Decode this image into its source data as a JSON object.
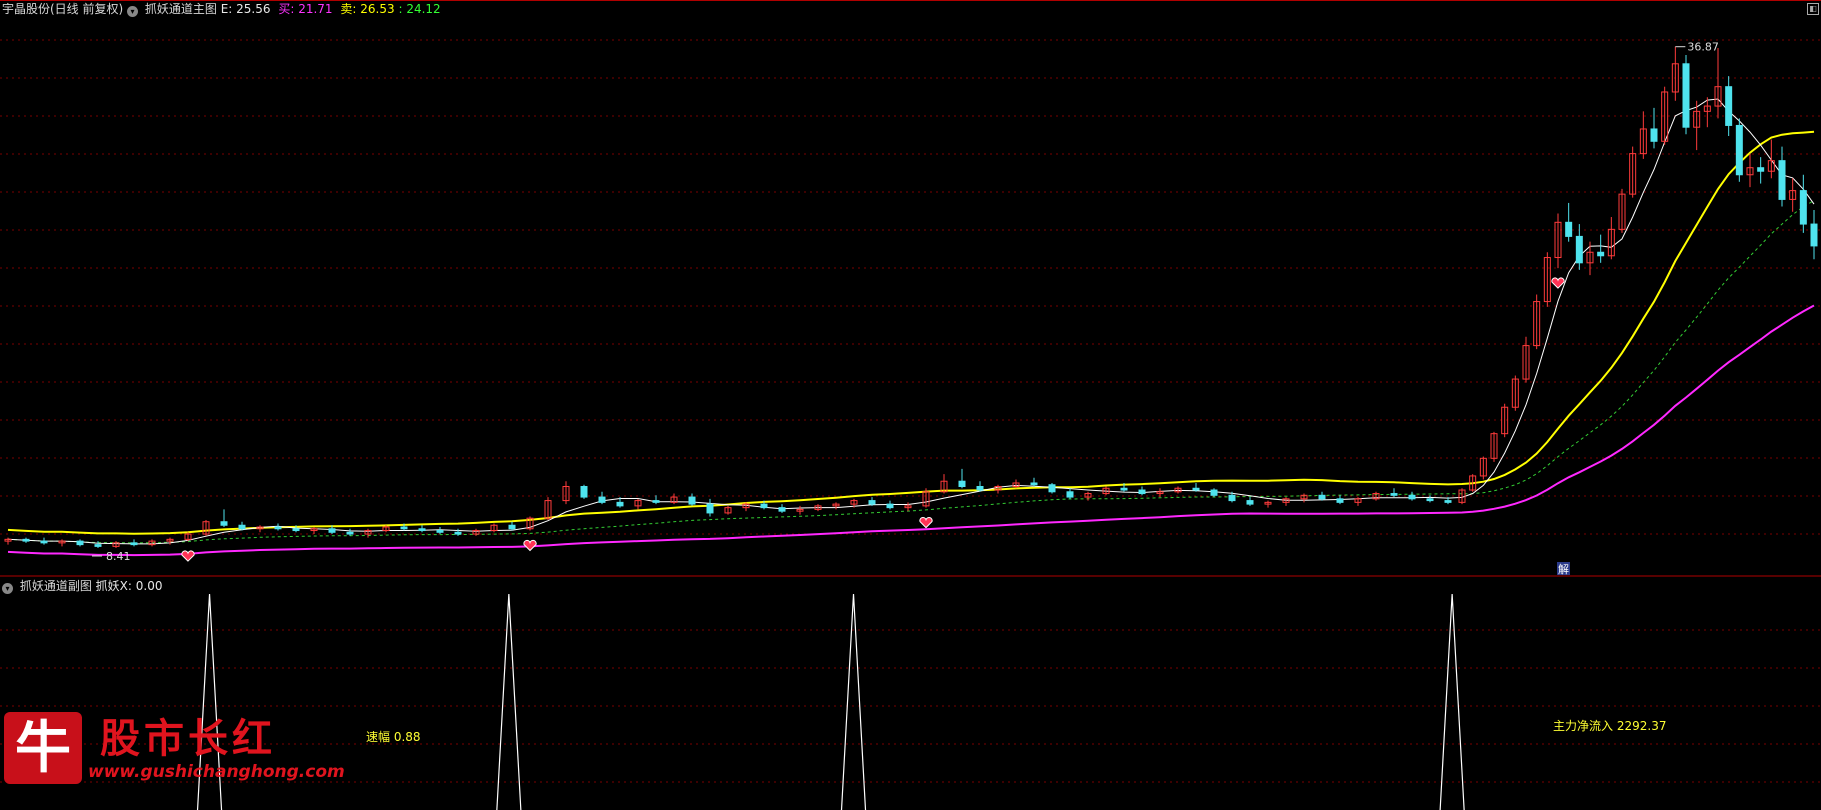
{
  "header": {
    "stock_name": "宇晶股份(日线 前复权)",
    "indicator_name": "抓妖通道主图",
    "e_label": "E:",
    "e_value": "25.56",
    "buy_label": "买:",
    "buy_value": "21.71",
    "sell_label": "卖:",
    "sell_value": "26.53",
    "extra_value": "24.12"
  },
  "sub_header": {
    "indicator_name": "抓妖通道副图",
    "signal_label": "抓妖X:",
    "signal_value": "0.00"
  },
  "annotations": {
    "high_price": "36.87",
    "low_price": "8.41",
    "jie_marker": "解",
    "speed_label": "速幅",
    "speed_value": "0.88",
    "inflow_label": "主力净流入",
    "inflow_value": "2292.37"
  },
  "watermark": {
    "logo_char": "牛",
    "title": "股市长红",
    "url": "www.gushichanghong.com"
  },
  "colors": {
    "background": "#000000",
    "grid": "#7a0000",
    "up_candle": "#ff3b3b",
    "down_candle": "#4fe3ee",
    "yellow_line": "#ffff00",
    "magenta_line": "#ff28ff",
    "green_dash": "#33cc33",
    "white_line": "#ffffff",
    "header_yellow": "#ffff00",
    "header_magenta": "#ff33ff",
    "header_green": "#33ff33"
  },
  "chart_data": {
    "type": "candlestick",
    "title": "宇晶股份(日线 前复权)",
    "ylim": [
      7.5,
      38.5
    ],
    "candles": [
      {
        "o": 8.8,
        "h": 9.0,
        "l": 8.6,
        "c": 8.9
      },
      {
        "o": 8.9,
        "h": 9.0,
        "l": 8.7,
        "c": 8.8
      },
      {
        "o": 8.8,
        "h": 9.0,
        "l": 8.6,
        "c": 8.7
      },
      {
        "o": 8.7,
        "h": 8.9,
        "l": 8.5,
        "c": 8.8
      },
      {
        "o": 8.8,
        "h": 8.9,
        "l": 8.5,
        "c": 8.6
      },
      {
        "o": 8.6,
        "h": 8.8,
        "l": 8.41,
        "c": 8.5
      },
      {
        "o": 8.5,
        "h": 8.8,
        "l": 8.41,
        "c": 8.7
      },
      {
        "o": 8.7,
        "h": 8.9,
        "l": 8.5,
        "c": 8.6
      },
      {
        "o": 8.6,
        "h": 8.9,
        "l": 8.5,
        "c": 8.8
      },
      {
        "o": 8.8,
        "h": 9.0,
        "l": 8.6,
        "c": 8.9
      },
      {
        "o": 8.9,
        "h": 9.3,
        "l": 8.8,
        "c": 9.2
      },
      {
        "o": 9.2,
        "h": 10.0,
        "l": 9.1,
        "c": 9.9
      },
      {
        "o": 9.9,
        "h": 10.6,
        "l": 9.6,
        "c": 9.7
      },
      {
        "o": 9.7,
        "h": 9.9,
        "l": 9.4,
        "c": 9.5
      },
      {
        "o": 9.5,
        "h": 9.7,
        "l": 9.3,
        "c": 9.6
      },
      {
        "o": 9.6,
        "h": 9.8,
        "l": 9.4,
        "c": 9.5
      },
      {
        "o": 9.5,
        "h": 9.7,
        "l": 9.3,
        "c": 9.4
      },
      {
        "o": 9.4,
        "h": 9.6,
        "l": 9.2,
        "c": 9.5
      },
      {
        "o": 9.5,
        "h": 9.7,
        "l": 9.2,
        "c": 9.3
      },
      {
        "o": 9.3,
        "h": 9.5,
        "l": 9.1,
        "c": 9.2
      },
      {
        "o": 9.2,
        "h": 9.5,
        "l": 9.0,
        "c": 9.4
      },
      {
        "o": 9.4,
        "h": 9.7,
        "l": 9.3,
        "c": 9.6
      },
      {
        "o": 9.6,
        "h": 9.8,
        "l": 9.4,
        "c": 9.5
      },
      {
        "o": 9.5,
        "h": 9.7,
        "l": 9.3,
        "c": 9.4
      },
      {
        "o": 9.4,
        "h": 9.6,
        "l": 9.2,
        "c": 9.3
      },
      {
        "o": 9.3,
        "h": 9.5,
        "l": 9.1,
        "c": 9.2
      },
      {
        "o": 9.2,
        "h": 9.5,
        "l": 9.1,
        "c": 9.4
      },
      {
        "o": 9.4,
        "h": 9.8,
        "l": 9.3,
        "c": 9.7
      },
      {
        "o": 9.7,
        "h": 9.9,
        "l": 9.4,
        "c": 9.5
      },
      {
        "o": 9.5,
        "h": 10.2,
        "l": 9.4,
        "c": 10.1
      },
      {
        "o": 10.1,
        "h": 11.3,
        "l": 10.0,
        "c": 11.1
      },
      {
        "o": 11.1,
        "h": 12.2,
        "l": 10.9,
        "c": 11.9
      },
      {
        "o": 11.9,
        "h": 12.0,
        "l": 11.2,
        "c": 11.3
      },
      {
        "o": 11.3,
        "h": 11.6,
        "l": 10.9,
        "c": 11.0
      },
      {
        "o": 11.0,
        "h": 11.3,
        "l": 10.7,
        "c": 10.8
      },
      {
        "o": 10.8,
        "h": 11.2,
        "l": 10.6,
        "c": 11.1
      },
      {
        "o": 11.1,
        "h": 11.4,
        "l": 10.9,
        "c": 11.0
      },
      {
        "o": 11.0,
        "h": 11.5,
        "l": 10.9,
        "c": 11.3
      },
      {
        "o": 11.3,
        "h": 11.5,
        "l": 10.8,
        "c": 10.9
      },
      {
        "o": 10.9,
        "h": 11.2,
        "l": 10.2,
        "c": 10.4
      },
      {
        "o": 10.4,
        "h": 10.8,
        "l": 10.3,
        "c": 10.7
      },
      {
        "o": 10.7,
        "h": 11.0,
        "l": 10.5,
        "c": 10.9
      },
      {
        "o": 10.9,
        "h": 11.1,
        "l": 10.6,
        "c": 10.7
      },
      {
        "o": 10.7,
        "h": 10.9,
        "l": 10.4,
        "c": 10.5
      },
      {
        "o": 10.5,
        "h": 10.8,
        "l": 10.3,
        "c": 10.6
      },
      {
        "o": 10.6,
        "h": 10.9,
        "l": 10.5,
        "c": 10.8
      },
      {
        "o": 10.8,
        "h": 11.0,
        "l": 10.6,
        "c": 10.9
      },
      {
        "o": 10.9,
        "h": 11.2,
        "l": 10.7,
        "c": 11.1
      },
      {
        "o": 11.1,
        "h": 11.3,
        "l": 10.8,
        "c": 10.9
      },
      {
        "o": 10.9,
        "h": 11.1,
        "l": 10.6,
        "c": 10.7
      },
      {
        "o": 10.7,
        "h": 11.0,
        "l": 10.5,
        "c": 10.8
      },
      {
        "o": 10.8,
        "h": 11.8,
        "l": 10.7,
        "c": 11.6
      },
      {
        "o": 11.6,
        "h": 12.6,
        "l": 11.5,
        "c": 12.2
      },
      {
        "o": 12.2,
        "h": 12.9,
        "l": 11.8,
        "c": 11.9
      },
      {
        "o": 11.9,
        "h": 12.2,
        "l": 11.6,
        "c": 11.7
      },
      {
        "o": 11.7,
        "h": 12.0,
        "l": 11.5,
        "c": 11.9
      },
      {
        "o": 11.9,
        "h": 12.3,
        "l": 11.8,
        "c": 12.1
      },
      {
        "o": 12.1,
        "h": 12.4,
        "l": 11.9,
        "c": 12.0
      },
      {
        "o": 12.0,
        "h": 12.1,
        "l": 11.5,
        "c": 11.6
      },
      {
        "o": 11.6,
        "h": 11.8,
        "l": 11.2,
        "c": 11.3
      },
      {
        "o": 11.3,
        "h": 11.6,
        "l": 11.1,
        "c": 11.5
      },
      {
        "o": 11.5,
        "h": 11.9,
        "l": 11.4,
        "c": 11.8
      },
      {
        "o": 11.8,
        "h": 12.1,
        "l": 11.6,
        "c": 11.7
      },
      {
        "o": 11.7,
        "h": 11.9,
        "l": 11.4,
        "c": 11.5
      },
      {
        "o": 11.5,
        "h": 11.8,
        "l": 11.3,
        "c": 11.6
      },
      {
        "o": 11.6,
        "h": 11.9,
        "l": 11.5,
        "c": 11.8
      },
      {
        "o": 11.8,
        "h": 12.1,
        "l": 11.6,
        "c": 11.7
      },
      {
        "o": 11.7,
        "h": 11.8,
        "l": 11.3,
        "c": 11.4
      },
      {
        "o": 11.4,
        "h": 11.6,
        "l": 11.0,
        "c": 11.1
      },
      {
        "o": 11.1,
        "h": 11.3,
        "l": 10.8,
        "c": 10.9
      },
      {
        "o": 10.9,
        "h": 11.1,
        "l": 10.7,
        "c": 11.0
      },
      {
        "o": 11.0,
        "h": 11.3,
        "l": 10.8,
        "c": 11.2
      },
      {
        "o": 11.2,
        "h": 11.5,
        "l": 11.0,
        "c": 11.4
      },
      {
        "o": 11.4,
        "h": 11.6,
        "l": 11.1,
        "c": 11.2
      },
      {
        "o": 11.2,
        "h": 11.4,
        "l": 10.9,
        "c": 11.0
      },
      {
        "o": 11.0,
        "h": 11.3,
        "l": 10.8,
        "c": 11.2
      },
      {
        "o": 11.2,
        "h": 11.6,
        "l": 11.1,
        "c": 11.5
      },
      {
        "o": 11.5,
        "h": 11.8,
        "l": 11.3,
        "c": 11.4
      },
      {
        "o": 11.4,
        "h": 11.6,
        "l": 11.1,
        "c": 11.2
      },
      {
        "o": 11.2,
        "h": 11.4,
        "l": 11.0,
        "c": 11.1
      },
      {
        "o": 11.1,
        "h": 11.3,
        "l": 10.9,
        "c": 11.0
      }
    ],
    "rally_candles": [
      {
        "o": 11.0,
        "h": 11.8,
        "l": 10.9,
        "c": 11.7
      },
      {
        "o": 11.7,
        "h": 12.6,
        "l": 11.6,
        "c": 12.5
      },
      {
        "o": 12.5,
        "h": 13.6,
        "l": 12.3,
        "c": 13.5
      },
      {
        "o": 13.5,
        "h": 15.0,
        "l": 13.3,
        "c": 14.9
      },
      {
        "o": 14.9,
        "h": 16.6,
        "l": 14.7,
        "c": 16.4
      },
      {
        "o": 16.4,
        "h": 18.2,
        "l": 16.2,
        "c": 18.0
      },
      {
        "o": 18.0,
        "h": 20.4,
        "l": 17.8,
        "c": 19.9
      },
      {
        "o": 19.9,
        "h": 22.8,
        "l": 19.7,
        "c": 22.4
      },
      {
        "o": 22.4,
        "h": 25.2,
        "l": 22.1,
        "c": 24.9
      },
      {
        "o": 24.9,
        "h": 27.4,
        "l": 24.3,
        "c": 26.9
      },
      {
        "o": 26.9,
        "h": 28.0,
        "l": 25.8,
        "c": 26.1
      },
      {
        "o": 26.1,
        "h": 26.8,
        "l": 24.2,
        "c": 24.6
      },
      {
        "o": 24.6,
        "h": 25.8,
        "l": 23.9,
        "c": 25.2
      },
      {
        "o": 25.2,
        "h": 26.2,
        "l": 24.6,
        "c": 25.0
      },
      {
        "o": 25.0,
        "h": 27.2,
        "l": 24.8,
        "c": 26.5
      },
      {
        "o": 26.5,
        "h": 28.8,
        "l": 26.3,
        "c": 28.5
      },
      {
        "o": 28.5,
        "h": 31.2,
        "l": 28.3,
        "c": 30.8
      },
      {
        "o": 30.8,
        "h": 33.2,
        "l": 30.5,
        "c": 32.2
      },
      {
        "o": 32.2,
        "h": 33.4,
        "l": 31.1,
        "c": 31.5
      },
      {
        "o": 31.5,
        "h": 34.6,
        "l": 31.3,
        "c": 34.3
      },
      {
        "o": 34.3,
        "h": 36.87,
        "l": 33.8,
        "c": 35.9
      },
      {
        "o": 35.9,
        "h": 36.4,
        "l": 31.9,
        "c": 32.3
      },
      {
        "o": 32.3,
        "h": 33.8,
        "l": 31.0,
        "c": 33.2
      },
      {
        "o": 33.2,
        "h": 34.0,
        "l": 32.3,
        "c": 33.5
      },
      {
        "o": 33.5,
        "h": 36.8,
        "l": 32.8,
        "c": 34.6
      },
      {
        "o": 34.6,
        "h": 35.2,
        "l": 31.8,
        "c": 32.4
      },
      {
        "o": 32.4,
        "h": 32.8,
        "l": 29.2,
        "c": 29.6
      },
      {
        "o": 29.6,
        "h": 30.8,
        "l": 28.9,
        "c": 30.0
      },
      {
        "o": 30.0,
        "h": 30.6,
        "l": 29.1,
        "c": 29.8
      },
      {
        "o": 29.8,
        "h": 31.6,
        "l": 29.4,
        "c": 30.4
      },
      {
        "o": 30.4,
        "h": 31.2,
        "l": 27.8,
        "c": 28.2
      },
      {
        "o": 28.2,
        "h": 29.4,
        "l": 27.5,
        "c": 28.7
      },
      {
        "o": 28.7,
        "h": 29.6,
        "l": 26.3,
        "c": 26.8
      },
      {
        "o": 26.8,
        "h": 27.6,
        "l": 24.8,
        "c": 25.56
      }
    ],
    "sub_indicator": {
      "name": "抓妖X",
      "ylim": [
        0,
        1
      ],
      "spikes_at_fraction": [
        0.11,
        0.275,
        0.465,
        0.795
      ]
    }
  }
}
